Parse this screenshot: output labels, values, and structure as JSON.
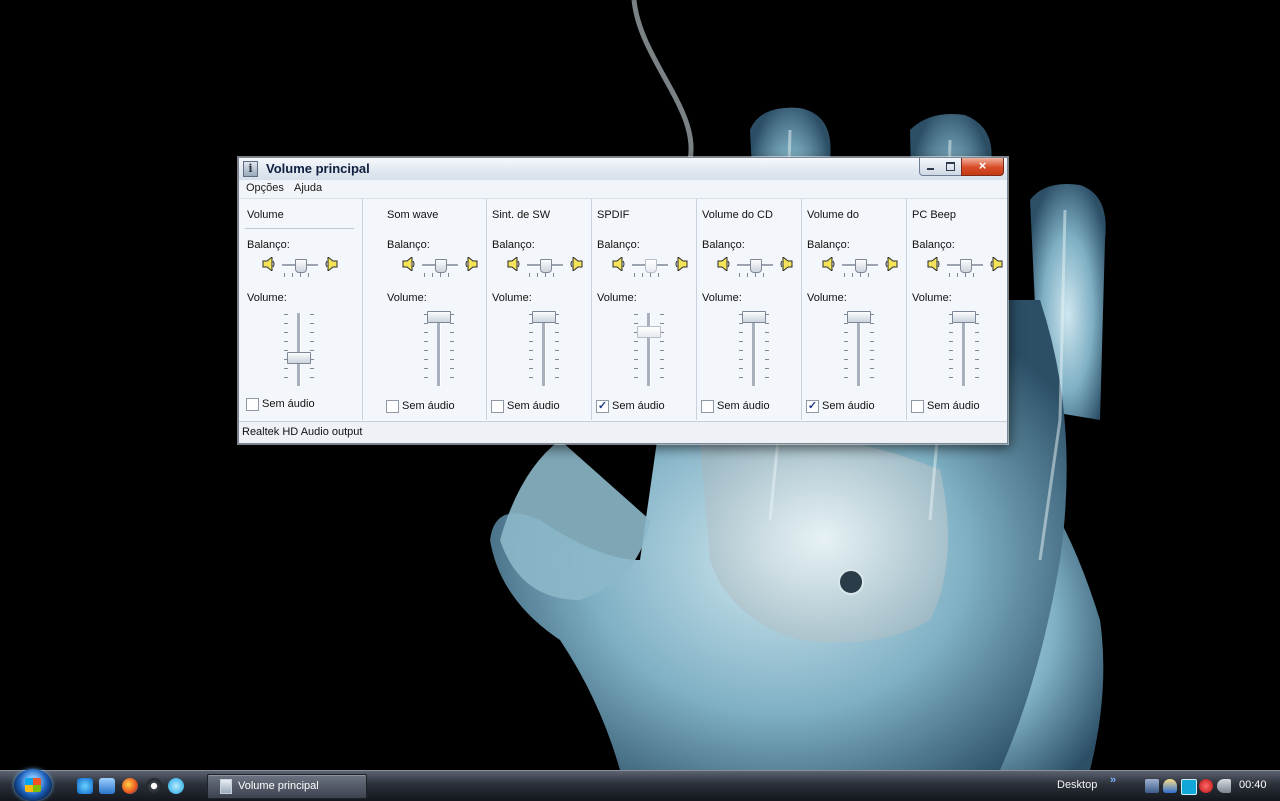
{
  "window": {
    "title": "Volume principal",
    "menus": [
      "Opções",
      "Ajuda"
    ],
    "status": "Realtek HD Audio output"
  },
  "channels": [
    {
      "name": "Volume",
      "balance_label": "Balanço:",
      "volume_label": "Volume:",
      "balance": 0.5,
      "volume": 0.38,
      "mute_label": "Sem áudio",
      "muted": false,
      "dimmed": false
    },
    {
      "name": "Som wave",
      "balance_label": "Balanço:",
      "volume_label": "Volume:",
      "balance": 0.5,
      "volume": 1.0,
      "mute_label": "Sem áudio",
      "muted": false,
      "dimmed": false
    },
    {
      "name": "Sint. de SW",
      "balance_label": "Balanço:",
      "volume_label": "Volume:",
      "balance": 0.5,
      "volume": 1.0,
      "mute_label": "Sem áudio",
      "muted": false,
      "dimmed": false
    },
    {
      "name": "SPDIF",
      "balance_label": "Balanço:",
      "volume_label": "Volume:",
      "balance": 0.5,
      "volume": 0.78,
      "mute_label": "Sem áudio",
      "muted": true,
      "dimmed": true
    },
    {
      "name": "Volume do CD",
      "balance_label": "Balanço:",
      "volume_label": "Volume:",
      "balance": 0.5,
      "volume": 1.0,
      "mute_label": "Sem áudio",
      "muted": false,
      "dimmed": false
    },
    {
      "name": "Volume do",
      "balance_label": "Balanço:",
      "volume_label": "Volume:",
      "balance": 0.5,
      "volume": 1.0,
      "mute_label": "Sem áudio",
      "muted": true,
      "dimmed": false
    },
    {
      "name": "PC Beep",
      "balance_label": "Balanço:",
      "volume_label": "Volume:",
      "balance": 0.5,
      "volume": 1.0,
      "mute_label": "Sem áudio",
      "muted": false,
      "dimmed": false
    }
  ],
  "taskbar": {
    "task_label": "Volume principal",
    "desktop_label": "Desktop",
    "chevron": "»",
    "clock": "00:40"
  },
  "icons": {
    "quick_launch": [
      "internet-explorer-icon",
      "outlook-icon",
      "firefox-icon",
      "media-player-icon",
      "skype-icon"
    ],
    "tray": [
      "network-icon",
      "security-icon",
      "app-icon",
      "antivirus-icon",
      "volume-icon"
    ]
  },
  "colors": {
    "accent": "#1f3a8a",
    "close_button": "#d84b27",
    "desktop_background": "#000000"
  }
}
